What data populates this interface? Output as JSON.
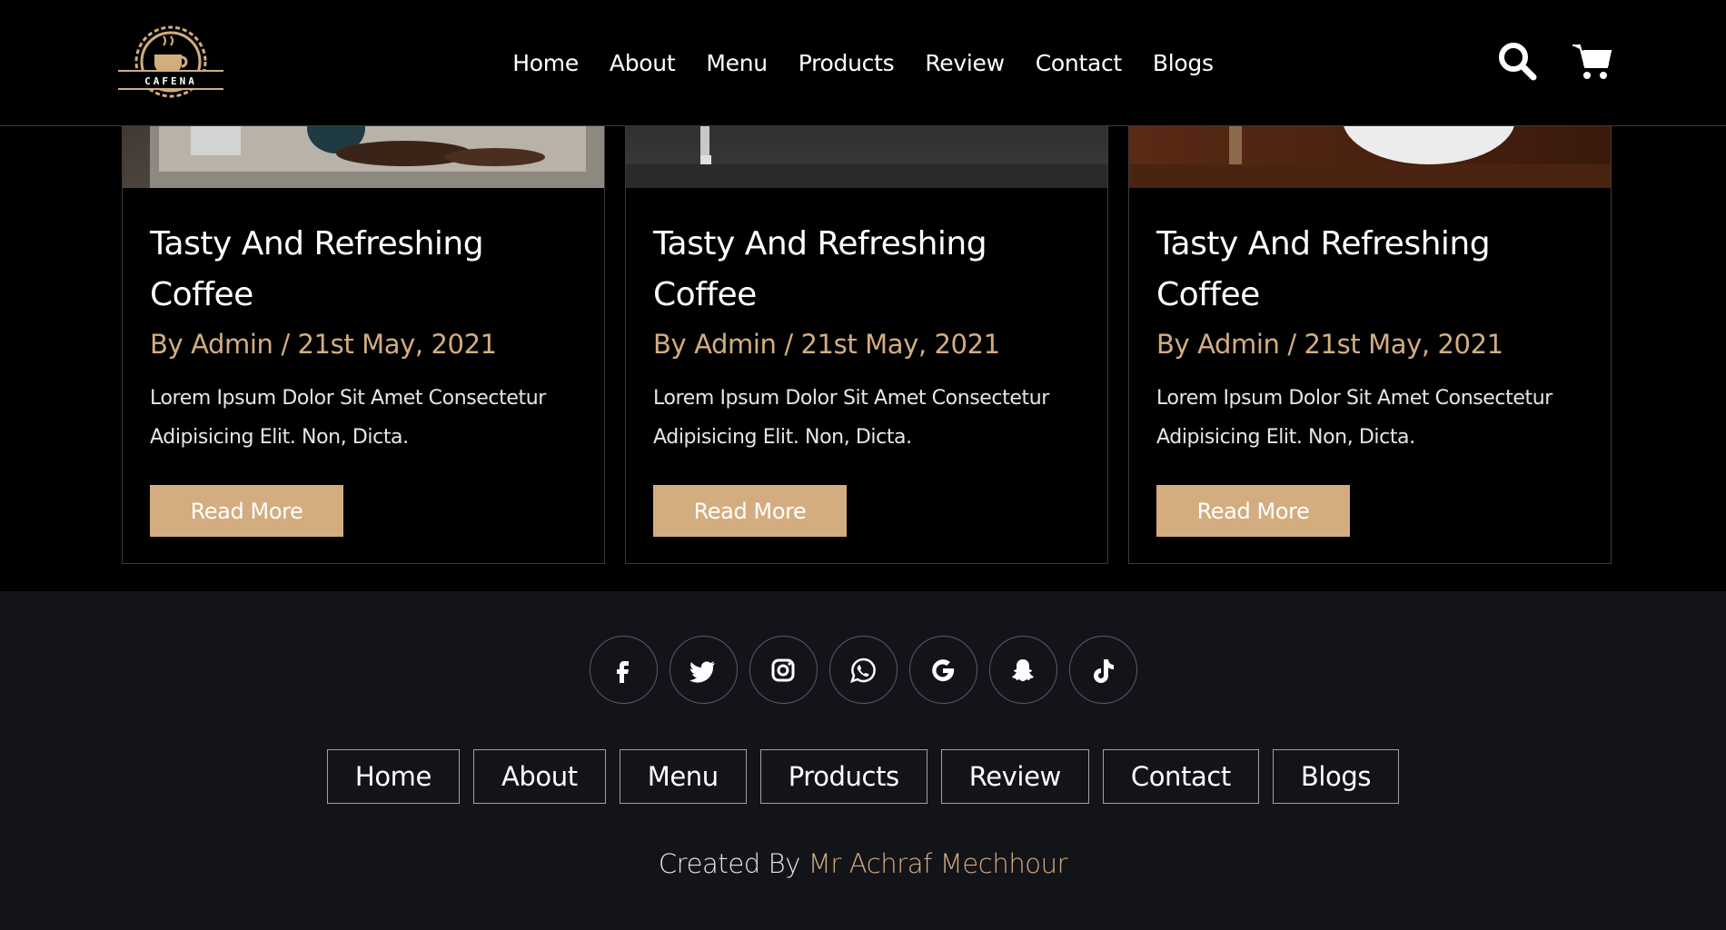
{
  "header": {
    "logo_text": "CAFENA",
    "nav": [
      "Home",
      "About",
      "Menu",
      "Products",
      "Review",
      "Contact",
      "Blogs"
    ],
    "icons": [
      "search-icon",
      "cart-icon"
    ]
  },
  "blogs": [
    {
      "title": "Tasty And Refreshing Coffee",
      "meta": "By Admin / 21st May, 2021",
      "excerpt": "Lorem Ipsum Dolor Sit Amet Consectetur Adipisicing Elit. Non, Dicta.",
      "button": "Read More"
    },
    {
      "title": "Tasty And Refreshing Coffee",
      "meta": "By Admin / 21st May, 2021",
      "excerpt": "Lorem Ipsum Dolor Sit Amet Consectetur Adipisicing Elit. Non, Dicta.",
      "button": "Read More"
    },
    {
      "title": "Tasty And Refreshing Coffee",
      "meta": "By Admin / 21st May, 2021",
      "excerpt": "Lorem Ipsum Dolor Sit Amet Consectetur Adipisicing Elit. Non, Dicta.",
      "button": "Read More"
    }
  ],
  "footer": {
    "social": [
      "facebook-icon",
      "twitter-icon",
      "instagram-icon",
      "whatsapp-icon",
      "google-icon",
      "snapchat-icon",
      "tiktok-icon"
    ],
    "nav": [
      "Home",
      "About",
      "Menu",
      "Products",
      "Review",
      "Contact",
      "Blogs"
    ],
    "credit_prefix": "Created By",
    "credit_author": "Mr Achraf Mechhour"
  },
  "colors": {
    "accent": "#d3ad7f",
    "footer_bg": "#13131a",
    "page_bg": "#000000"
  }
}
